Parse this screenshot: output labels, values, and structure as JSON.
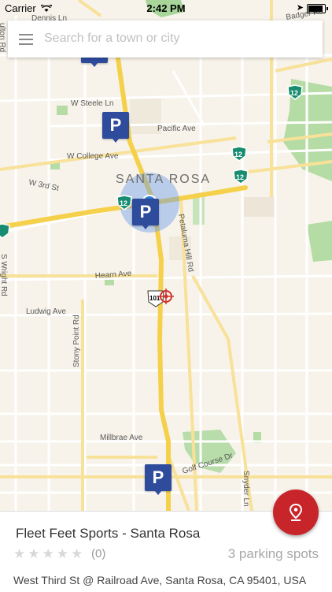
{
  "status_bar": {
    "carrier": "Carrier",
    "time": "2:42 PM"
  },
  "search": {
    "placeholder": "Search for a town or city"
  },
  "map": {
    "city_label": "SANTA ROSA",
    "streets": {
      "dennis_ln": "Dennis Ln",
      "badger_rd": "Badger Rd",
      "fulton_rd": "ulton Rd",
      "w_steele_ln": "W Steele Ln",
      "pacific_ave": "Pacific Ave",
      "w_college_ave": "W College Ave",
      "w_3rd_st": "W 3rd St",
      "s_wright_rd": "S Wright Rd",
      "petaluma_hill_rd": "Petaluma Hill Rd",
      "hearn_ave": "Hearn Ave",
      "ludwig_ave": "Ludwig Ave",
      "stony_point_rd": "Stony Point Rd",
      "millbrae_ave": "Millbrae Ave",
      "golf_course_dr": "Golf Course Dr",
      "snyder_ln": "Snyder Ln"
    },
    "shields": {
      "hwy12": "12",
      "us101": "101"
    },
    "parking_marker_label": "P"
  },
  "location": {
    "name": "Fleet Feet Sports - Santa Rosa",
    "rating_stars": "★★★★★",
    "rating_count": "(0)",
    "parking_spots": "3 parking spots",
    "address": "West Third St @ Railroad Ave, Santa Rosa, CA 95401, USA"
  },
  "colors": {
    "accent_red": "#c8252b",
    "marker_blue": "#2e4b9c",
    "highway_yellow": "#f5d04b"
  }
}
